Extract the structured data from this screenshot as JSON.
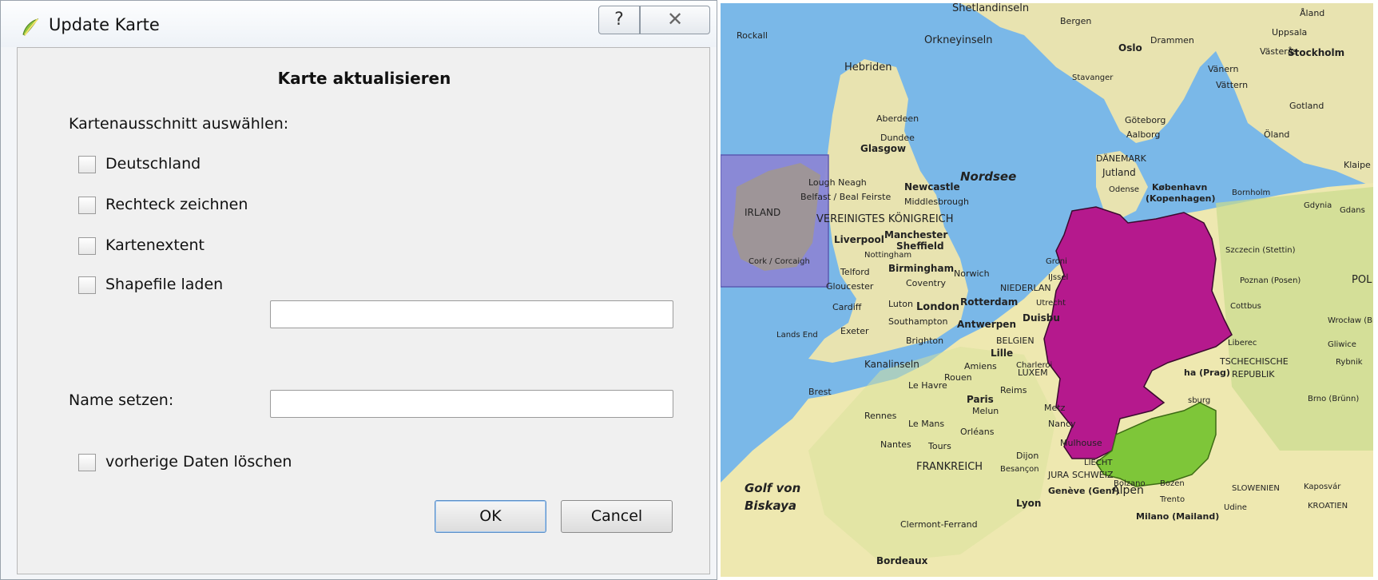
{
  "window": {
    "title": "Update Karte",
    "help_glyph": "?",
    "close_glyph": "✕"
  },
  "dialog": {
    "heading": "Karte aktualisieren",
    "section_label": "Kartenausschnitt auswählen:",
    "options": [
      {
        "label": "Deutschland",
        "checked": false
      },
      {
        "label": "Rechteck zeichnen",
        "checked": false
      },
      {
        "label": "Kartenextent",
        "checked": false
      },
      {
        "label": "Shapefile laden",
        "checked": false
      }
    ],
    "shapefile_value": "",
    "name_label": "Name setzen:",
    "name_value": "",
    "delete_label": "vorherige Daten löschen",
    "delete_checked": false,
    "ok_label": "OK",
    "cancel_label": "Cancel"
  },
  "map": {
    "colors": {
      "sea": "#7ab8e8",
      "land": "#f0eab3",
      "land_green": "#c9dc8f",
      "selection": "#b5198d",
      "austria": "#7ec639",
      "ireland_box": "#8b87d6"
    },
    "labels": {
      "shetland": "Shetlandinseln",
      "rockall": "Rockall",
      "orkney": "Orkneyinseln",
      "hebriden": "Hebriden",
      "aberdeen": "Aberdeen",
      "dundee": "Dundee",
      "glasgow": "Glasgow",
      "lough": "Lough Neagh",
      "belfast": "Belfast / Beal Feirste",
      "newcastle": "Newcastle",
      "middlesbrough": "Middlesbrough",
      "irland": "IRLAND",
      "vk": "VEREINIGTES KÖNIGREICH",
      "manchester": "Manchester",
      "liverpool": "Liverpool",
      "sheffield": "Sheffield",
      "nottingham": "Nottingham",
      "telford": "Telford",
      "birmingham": "Birmingham",
      "norwich": "Norwich",
      "cork": "Cork / Corcaigh",
      "gloucester": "Gloucester",
      "coventry": "Coventry",
      "cardiff": "Cardiff",
      "luton": "Luton",
      "london": "London",
      "southampton": "Southampton",
      "exeter": "Exeter",
      "brighton": "Brighton",
      "landsend": "Lands End",
      "nordsee": "Nordsee",
      "bergen": "Bergen",
      "oslo": "Oslo",
      "stavanger": "Stavanger",
      "uppsala": "Uppsala",
      "stockholm": "Stockholm",
      "vanern": "Vänern",
      "vattern": "Vättern",
      "gotland": "Gotland",
      "oland": "Öland",
      "goteborg": "Göteborg",
      "aalborg": "Aalborg",
      "danemark": "DÄNEMARK",
      "jutland": "Jutland",
      "odense": "Odense",
      "kobenhavn": "København",
      "kopenhagen": "(Kopenhagen)",
      "bornholm": "Bornholm",
      "gdynia": "Gdynia",
      "gdansk": "Gdans",
      "szczecin": "Szczecin (Stettin)",
      "poznan": "Poznan (Posen)",
      "pol": "POL",
      "rotterdam": "Rotterdam",
      "niederlande": "NIEDERLAN",
      "utrecht": "Utrecht",
      "antwerpen": "Antwerpen",
      "duisburg": "Duisbu",
      "belgien": "BELGIEN",
      "lille": "Lille",
      "kanalinseln": "Kanalinseln",
      "charleroi": "Charleroi",
      "amiens": "Amiens",
      "luxem": "LUXEM",
      "rouen": "Rouen",
      "lehavre": "Le Havre",
      "reims": "Reims",
      "brest": "Brest",
      "paris": "Paris",
      "melun": "Melun",
      "metz": "Metz",
      "nancy": "Nancy",
      "rennes": "Rennes",
      "lemans": "Le Mans",
      "orleans": "Orléans",
      "nantes": "Nantes",
      "tours": "Tours",
      "mulhouse": "Mulhouse",
      "dijon": "Dijon",
      "frankreich": "FRANKREICH",
      "besancon": "Besançon",
      "jura": "JURA",
      "schweiz": "SCHWEIZ",
      "liecht": "LIECHT",
      "geneve": "Genève (Genf)",
      "alpen": "Alpen",
      "bolzano": "Bolzano",
      "bozen": "Bozen",
      "trento": "Trento",
      "udine": "Udine",
      "slowenien": "SLOWENIEN",
      "kroatien": "KROATIEN",
      "kaposvar": "Kaposvár",
      "lyon": "Lyon",
      "clermont": "Clermont-Ferrand",
      "milano": "Milano (Mailand)",
      "bordeaux": "Bordeaux",
      "golf1": "Golf von",
      "golf2": "Biskaya",
      "cottbus": "Cottbus",
      "wroclaw": "Wrocław (Bre",
      "liberec": "Liberec",
      "gliwice": "Gliwice",
      "tschechische": "TSCHECHISCHE",
      "republik": "REPUBLIK",
      "prag": "ha (Prag)",
      "rybnik": "Rybnik",
      "brno": "Brno (Brünn)",
      "sburg": "sburg",
      "groni": "Groni",
      "ijssel": "IJssel",
      "drammen": "Drammen",
      "vasteras": "Västerås",
      "klaipe": "Klaipe",
      "aland": "Åland",
      "bmo": "Brno"
    }
  }
}
